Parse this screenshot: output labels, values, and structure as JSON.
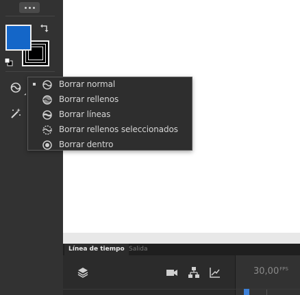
{
  "toolbar": {
    "fill_color": "#1466c8",
    "stroke_color": "#000000",
    "icons": {
      "overflow": "more-horizontal-icon",
      "swap": "swap-colors-icon",
      "default": "default-colors-icon",
      "eraser": "eraser-tool-icon",
      "magic": "magic-wand-icon"
    }
  },
  "eraser_menu": {
    "items": [
      {
        "label": "Borrar normal",
        "icon": "erase-normal-icon",
        "checked": true
      },
      {
        "label": "Borrar rellenos",
        "icon": "erase-fills-icon",
        "checked": false
      },
      {
        "label": "Borrar líneas",
        "icon": "erase-lines-icon",
        "checked": false
      },
      {
        "label": "Borrar rellenos seleccionados",
        "icon": "erase-selected-fills-icon",
        "checked": false
      },
      {
        "label": "Borrar dentro",
        "icon": "erase-inside-icon",
        "checked": false
      }
    ]
  },
  "timeline": {
    "tabs": [
      {
        "label": "Línea de tiempo",
        "active": true
      },
      {
        "label": "Salida",
        "active": false
      }
    ],
    "fps_value": "30,00",
    "fps_unit": "FPS",
    "icons": [
      "layers-icon",
      "camera-icon",
      "hierarchy-icon",
      "graph-icon"
    ]
  }
}
